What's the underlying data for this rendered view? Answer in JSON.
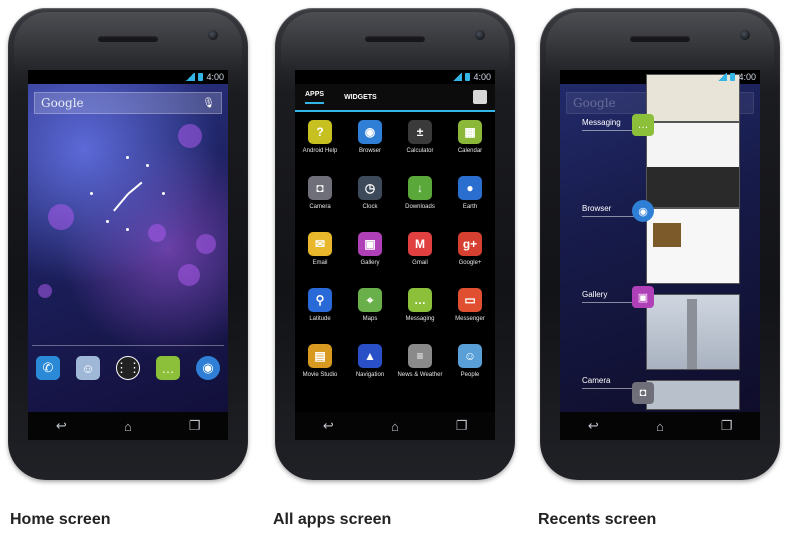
{
  "captions": {
    "home": "Home screen",
    "all_apps": "All apps screen",
    "recents": "Recents screen"
  },
  "status": {
    "time": "4:00"
  },
  "home": {
    "search_label": "Google"
  },
  "all_apps": {
    "tabs": [
      "APPS",
      "WIDGETS"
    ],
    "apps": [
      {
        "label": "Android Help",
        "icon": "help-icon",
        "color": "#c6c021"
      },
      {
        "label": "Browser",
        "icon": "globe-icon",
        "color": "#2f7fd6"
      },
      {
        "label": "Calculator",
        "icon": "calculator-icon",
        "color": "#3a3a3a"
      },
      {
        "label": "Calendar",
        "icon": "calendar-icon",
        "color": "#8cb83a"
      },
      {
        "label": "Camera",
        "icon": "camera-icon",
        "color": "#6f6f7a"
      },
      {
        "label": "Clock",
        "icon": "clock-icon",
        "color": "#3d4a5a"
      },
      {
        "label": "Downloads",
        "icon": "download-icon",
        "color": "#5aa83a"
      },
      {
        "label": "Earth",
        "icon": "earth-icon",
        "color": "#2a6fd0"
      },
      {
        "label": "Email",
        "icon": "email-icon",
        "color": "#e8b72b"
      },
      {
        "label": "Gallery",
        "icon": "gallery-icon",
        "color": "#b040b8"
      },
      {
        "label": "Gmail",
        "icon": "gmail-icon",
        "color": "#e04040"
      },
      {
        "label": "Google+",
        "icon": "google-plus-icon",
        "color": "#d64030"
      },
      {
        "label": "Latitude",
        "icon": "latitude-icon",
        "color": "#2a6ad8"
      },
      {
        "label": "Maps",
        "icon": "maps-icon",
        "color": "#6ab04a"
      },
      {
        "label": "Messaging",
        "icon": "messaging-icon",
        "color": "#8cc03a"
      },
      {
        "label": "Messenger",
        "icon": "messenger-icon",
        "color": "#e05030"
      },
      {
        "label": "Movie Studio",
        "icon": "movie-studio-icon",
        "color": "#d89a20"
      },
      {
        "label": "Navigation",
        "icon": "navigation-icon",
        "color": "#2a50c8"
      },
      {
        "label": "News & Weather",
        "icon": "news-weather-icon",
        "color": "#8a8a8a"
      },
      {
        "label": "People",
        "icon": "people-icon",
        "color": "#5aa0d8"
      }
    ]
  },
  "recents": {
    "search_label": "Google",
    "items": [
      {
        "label": "Messaging",
        "icon": "messaging-icon",
        "color": "#8cc03a"
      },
      {
        "label": "Browser",
        "icon": "globe-icon",
        "color": "#2f7fd6"
      },
      {
        "label": "Gallery",
        "icon": "gallery-icon",
        "color": "#b040b8"
      },
      {
        "label": "Camera",
        "icon": "camera-icon",
        "color": "#6f6f7a"
      }
    ]
  },
  "colors": {
    "accent": "#33b5e5"
  }
}
